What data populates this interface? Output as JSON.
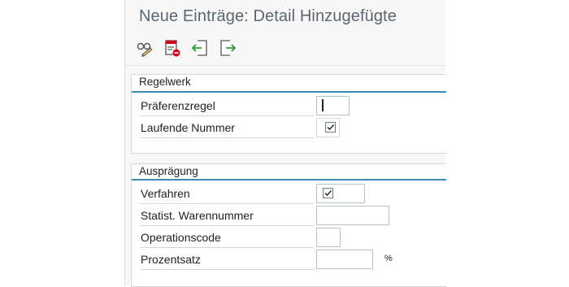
{
  "header": {
    "title": "Neue Einträge: Detail Hinzugefügte"
  },
  "toolbar": {
    "buttons": [
      {
        "name": "display-change-toggle",
        "icon": "glasses-pencil-icon"
      },
      {
        "name": "delete",
        "icon": "delete-entry-icon"
      },
      {
        "name": "previous-entry",
        "icon": "previous-entry-icon"
      },
      {
        "name": "next-entry",
        "icon": "next-entry-icon"
      }
    ]
  },
  "groups": {
    "regelwerk": {
      "title": "Regelwerk",
      "praeferenzregel_label": "Präferenzregel",
      "praeferenzregel_value": "",
      "laufende_nummer_label": "Laufende Nummer",
      "laufende_nummer_checked": true
    },
    "auspraegung": {
      "title": "Ausprägung",
      "verfahren_label": "Verfahren",
      "verfahren_checked": true,
      "warennummer_label": "Statist. Warennummer",
      "warennummer_value": "",
      "operationscode_label": "Operationscode",
      "operationscode_value": "",
      "prozentsatz_label": "Prozentsatz",
      "prozentsatz_value": "",
      "prozentsatz_unit": "%"
    }
  },
  "colors": {
    "accent": "#3b8db8",
    "title": "#5b6670",
    "delete_red": "#d0021b",
    "nav_green": "#2e9a3a"
  }
}
